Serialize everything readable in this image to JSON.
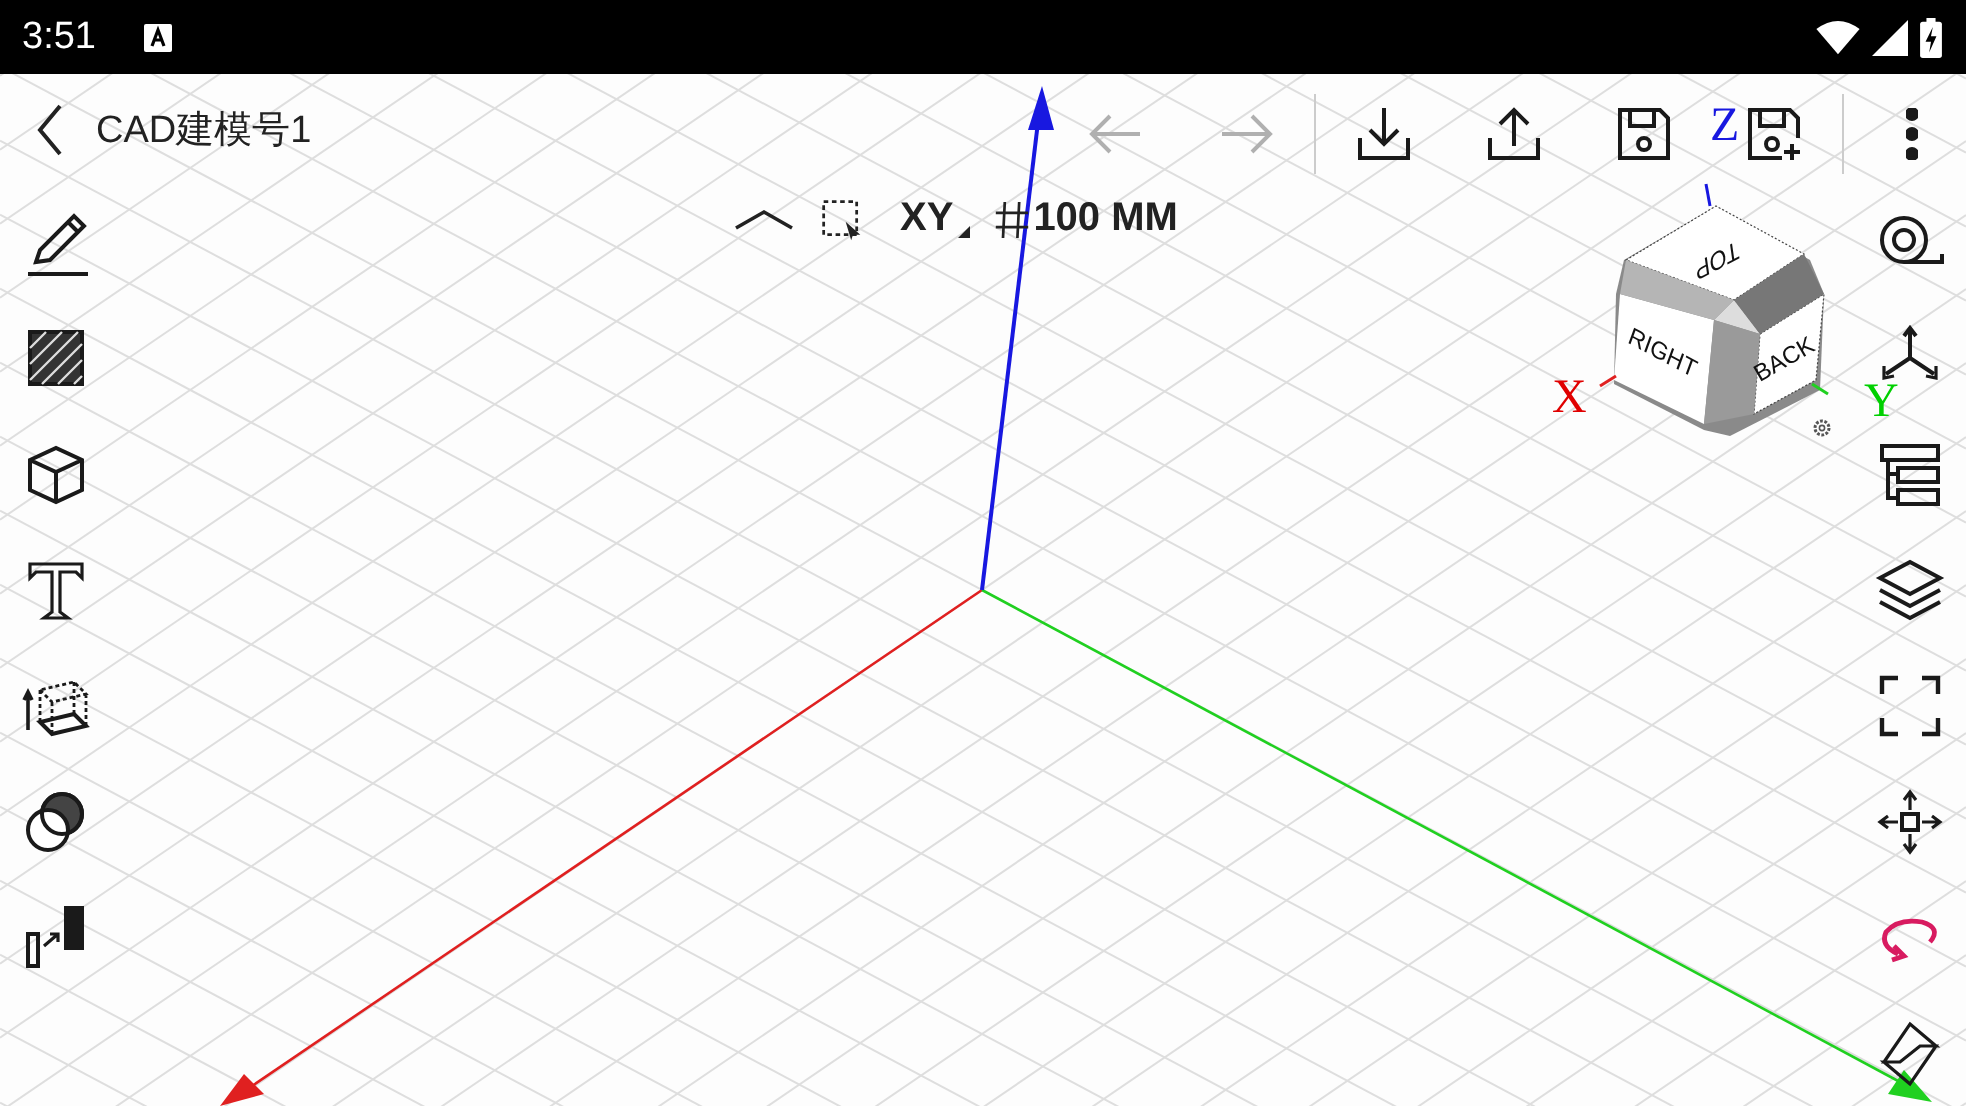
{
  "status_bar": {
    "time": "3:51"
  },
  "header": {
    "title": "CAD建模号1"
  },
  "top_actions": [
    {
      "kind": "undo",
      "disabled": true
    },
    {
      "kind": "redo",
      "disabled": true
    },
    {
      "kind": "import",
      "disabled": false
    },
    {
      "kind": "export",
      "disabled": false
    },
    {
      "kind": "save",
      "disabled": false
    },
    {
      "kind": "save_as",
      "disabled": false
    },
    {
      "kind": "more",
      "disabled": false
    }
  ],
  "view_bar": {
    "plane": "XY",
    "grid_size": "100 MM"
  },
  "left_tools": [
    {
      "kind": "sketch"
    },
    {
      "kind": "hatch"
    },
    {
      "kind": "box"
    },
    {
      "kind": "text"
    },
    {
      "kind": "extrude"
    },
    {
      "kind": "boolean"
    },
    {
      "kind": "scale"
    }
  ],
  "right_tools": [
    {
      "kind": "measure"
    },
    {
      "kind": "axes"
    },
    {
      "kind": "tree"
    },
    {
      "kind": "layers"
    },
    {
      "kind": "fit"
    },
    {
      "kind": "move"
    },
    {
      "kind": "rotate"
    },
    {
      "kind": "flip"
    }
  ],
  "view_cube": {
    "faces": [
      "TOP",
      "RIGHT",
      "BACK"
    ],
    "axis_labels": [
      {
        "label": "X",
        "color": "#e00000"
      },
      {
        "label": "Y",
        "color": "#00d000"
      },
      {
        "label": "Z",
        "color": "#1818e0"
      }
    ]
  }
}
